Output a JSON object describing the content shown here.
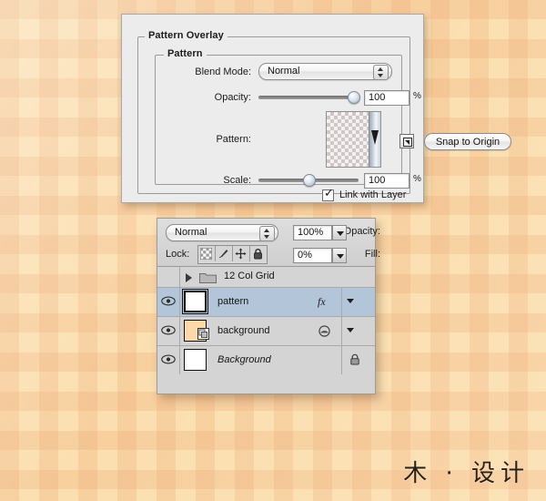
{
  "background": {
    "pattern": "plaid-gingham",
    "base_color": "#fbdfb0",
    "accent_color": "#eeac76"
  },
  "dialog": {
    "group_title": "Pattern Overlay",
    "subgroup_title": "Pattern",
    "blend_mode": {
      "label": "Blend Mode:",
      "value": "Normal"
    },
    "opacity": {
      "label": "Opacity:",
      "value": "100",
      "unit": "%",
      "slider_percent": 100
    },
    "pattern": {
      "label": "Pattern:",
      "preset_icon": "pattern-preset-icon",
      "snap_button": "Snap to Origin"
    },
    "scale": {
      "label": "Scale:",
      "value": "100",
      "unit": "%",
      "slider_percent": 50
    },
    "link_with_layer": {
      "label": "Link with Layer",
      "checked": true,
      "check_glyph": "✓"
    }
  },
  "layers_panel": {
    "blend_mode": "Normal",
    "opacity": {
      "label": "Opacity:",
      "value": "100%"
    },
    "fill": {
      "label": "Fill:",
      "value": "0%"
    },
    "lock": {
      "label": "Lock:",
      "icons": [
        "lock-transparency-icon",
        "lock-image-icon",
        "lock-position-icon",
        "lock-all-icon"
      ]
    },
    "group": {
      "name": "12 Col Grid",
      "icon": "folder-icon",
      "disclosure": "chevron-right-icon"
    },
    "rows": [
      {
        "name": "pattern",
        "selected": true,
        "italic": false,
        "badge": "fx",
        "badge_name": "layer-effects-fx-icon",
        "has_dropdown": true,
        "thumb_style": "outlined",
        "thumb_color": "#ffffff",
        "eye": "eye-icon"
      },
      {
        "name": "background",
        "selected": false,
        "italic": false,
        "badge": "",
        "badge_name": "smart-object-icon",
        "has_dropdown": true,
        "thumb_style": "plain",
        "thumb_color": "#fbd9a8",
        "eye": "eye-icon"
      },
      {
        "name": "Background",
        "selected": false,
        "italic": true,
        "badge": "",
        "badge_name": "lock-icon",
        "has_dropdown": false,
        "thumb_style": "plain",
        "thumb_color": "#ffffff",
        "eye": "eye-icon"
      }
    ]
  },
  "watermark": {
    "text": "木 · 设计"
  }
}
